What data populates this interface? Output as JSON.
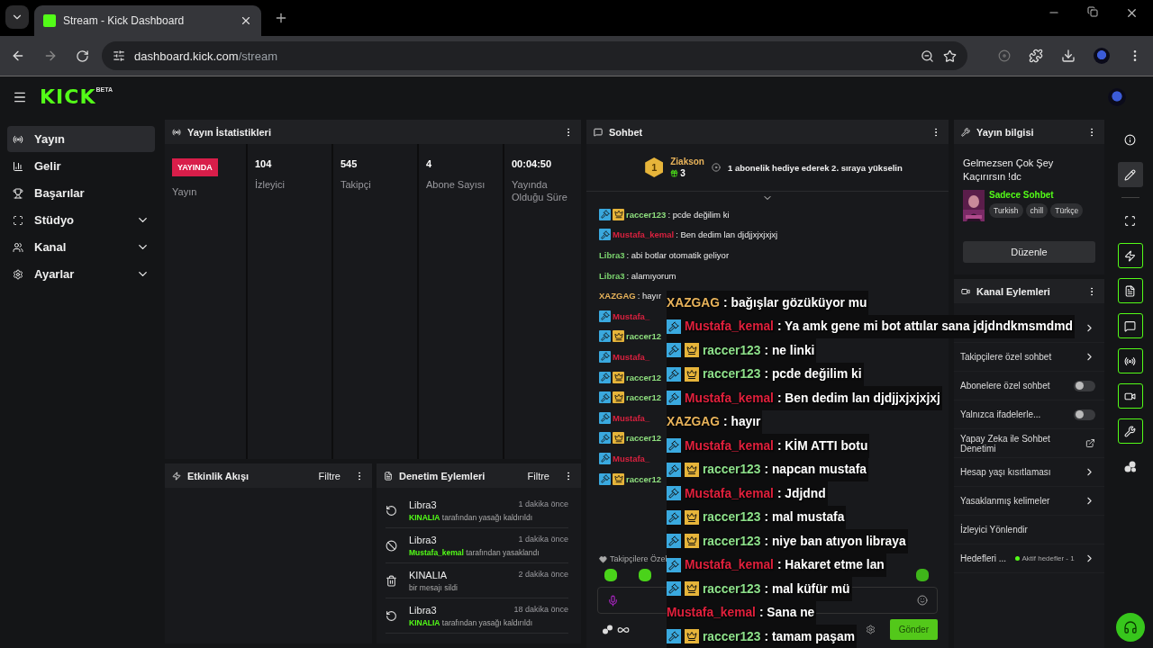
{
  "browser": {
    "tab_title": "Stream - Kick Dashboard",
    "url_host": "dashboard.kick.com",
    "url_path": "/stream"
  },
  "header": {
    "logo": "KICK",
    "logo_badge": "BETA"
  },
  "sidebar": {
    "items": [
      {
        "label": "Yayın",
        "selected": true,
        "expandable": false
      },
      {
        "label": "Gelir",
        "selected": false,
        "expandable": false
      },
      {
        "label": "Başarılar",
        "selected": false,
        "expandable": false
      },
      {
        "label": "Stüdyo",
        "selected": false,
        "expandable": true
      },
      {
        "label": "Kanal",
        "selected": false,
        "expandable": true
      },
      {
        "label": "Ayarlar",
        "selected": false,
        "expandable": true
      }
    ]
  },
  "stats": {
    "title": "Yayın İstatistikleri",
    "status": "YAYINDA",
    "status_label": "Yayın",
    "metrics": [
      {
        "value": "104",
        "label": "İzleyici"
      },
      {
        "value": "545",
        "label": "Takipçi"
      },
      {
        "value": "4",
        "label": "Abone Sayısı"
      },
      {
        "value": "00:04:50",
        "label": "Yayında Olduğu Süre"
      }
    ]
  },
  "activity": {
    "title": "Etkinlik Akışı",
    "filter": "Filtre"
  },
  "moderation": {
    "title": "Denetim Eylemleri",
    "filter": "Filtre",
    "entries": [
      {
        "kind": "unban",
        "user": "Libra3",
        "time": "1 dakika önce",
        "actor": "KINALIA",
        "action": "tarafından yasağı kaldırıldı"
      },
      {
        "kind": "ban",
        "user": "Libra3",
        "time": "1 dakika önce",
        "actor": "Mustafa_kemal",
        "action": "tarafından yasaklandı"
      },
      {
        "kind": "delete",
        "user": "KINALIA",
        "time": "2 dakika önce",
        "action": "bir mesajı sildi"
      },
      {
        "kind": "unban",
        "user": "Libra3",
        "time": "18 dakika önce",
        "actor": "KINALIA",
        "action": "tarafından yasağı kaldırıldı"
      }
    ]
  },
  "chat": {
    "title": "Sohbet",
    "leader": {
      "rank": "1",
      "name": "Ziakson",
      "gifts": "3"
    },
    "promo": "1 abonelik hediye ederek 2. sıraya yükselin",
    "messages": [
      {
        "kind": "full",
        "user": "raccer123",
        "color": "#8fe07f",
        "text": ": pcde değilim ki",
        "moderator": true,
        "subscriber": true
      },
      {
        "kind": "full",
        "user": "Mustafa_kemal",
        "color": "#d9213f",
        "text": ": Ben dedim lan djdjjxjxjxjxj",
        "moderator": true,
        "subscriber": false
      },
      {
        "kind": "full",
        "user": "Libra3",
        "color": "#7bd36e",
        "text": ": abi botlar otomatik geliyor",
        "moderator": false,
        "subscriber": false
      },
      {
        "kind": "full",
        "user": "Libra3",
        "color": "#7bd36e",
        "text": ": alamıyorum",
        "moderator": false,
        "subscriber": false
      },
      {
        "kind": "full",
        "user": "XAZGAG",
        "color": "#e8b35a",
        "text": ": hayır",
        "moderator": false,
        "subscriber": false
      },
      {
        "kind": "fragment",
        "user": "Mustafa_",
        "color": "#d9213f",
        "moderator": true,
        "subscriber": false
      },
      {
        "kind": "fragment",
        "user": "raccer12",
        "color": "#8fe07f",
        "moderator": true,
        "subscriber": true
      },
      {
        "kind": "fragment",
        "user": "Mustafa_",
        "color": "#d9213f",
        "moderator": true,
        "subscriber": false
      },
      {
        "kind": "fragment",
        "user": "raccer12",
        "color": "#8fe07f",
        "moderator": true,
        "subscriber": true
      },
      {
        "kind": "fragment",
        "user": "raccer12",
        "color": "#8fe07f",
        "moderator": true,
        "subscriber": true
      },
      {
        "kind": "fragment",
        "user": "Mustafa_",
        "color": "#d9213f",
        "moderator": true,
        "subscriber": false
      },
      {
        "kind": "fragment",
        "user": "raccer12",
        "color": "#8fe07f",
        "moderator": true,
        "subscriber": true
      },
      {
        "kind": "fragment",
        "user": "Mustafa_",
        "color": "#d9213f",
        "moderator": true,
        "subscriber": false
      },
      {
        "kind": "fragment",
        "user": "raccer12",
        "color": "#8fe07f",
        "moderator": true,
        "subscriber": true
      }
    ],
    "follower_label": "Takipçilere Özel",
    "send": "Gönder"
  },
  "stream_info": {
    "title": "Yayın bilgisi",
    "stream_title": "Gelmezsen Çok Şey Kaçırırsın !dc",
    "category": "Sadece Sohbet",
    "tags": [
      "Turkish",
      "chill",
      "Türkçe"
    ],
    "edit": "Düzenle"
  },
  "channel_actions": {
    "title": "Kanal Eylemleri",
    "items": [
      {
        "kind": "chevron"
      },
      {
        "kind": "chevron",
        "label": "Takipçilere özel sohbet"
      },
      {
        "kind": "toggle",
        "label": "Abonelere özel sohbet",
        "on": false
      },
      {
        "kind": "toggle",
        "label": "Yalnızca ifadelerle...",
        "on": false
      },
      {
        "kind": "external",
        "label": "Yapay Zeka ile Sohbet Denetimi"
      },
      {
        "kind": "chevron",
        "label": "Hesap yaşı kısıtlaması"
      },
      {
        "kind": "chevron",
        "label": "Yasaklanmış kelimeler"
      },
      {
        "kind": "plain",
        "label": "İzleyici Yönlendir"
      },
      {
        "kind": "goal",
        "label": "Hedefleri ...",
        "status": "Aktif hedefler - 1"
      }
    ]
  },
  "rail": {
    "items": [
      {
        "selected": false,
        "highlighted": false
      },
      {
        "selected": true,
        "highlighted": false
      },
      {
        "selected": false,
        "highlighted": false
      },
      {
        "selected": false,
        "highlighted": true
      },
      {
        "selected": false,
        "highlighted": true
      },
      {
        "selected": false,
        "highlighted": true
      },
      {
        "selected": false,
        "highlighted": true
      },
      {
        "selected": false,
        "highlighted": true
      },
      {
        "selected": false,
        "highlighted": true
      },
      {
        "selected": false,
        "highlighted": false
      }
    ]
  },
  "overlay": {
    "messages": [
      {
        "user": "XAZGAG",
        "color": "#e8b35a",
        "text": ": bağışlar gözüküyor mu",
        "moderator": false,
        "subscriber": false
      },
      {
        "user": "Mustafa_kemal",
        "color": "#e0203c",
        "text": ": Ya amk gene mi bot attılar sana jdjdndkmsmdmd",
        "moderator": true,
        "subscriber": false
      },
      {
        "user": "raccer123",
        "color": "#8de08a",
        "text": ": ne linki",
        "moderator": true,
        "subscriber": true
      },
      {
        "user": "raccer123",
        "color": "#8de08a",
        "text": ": pcde değilim ki",
        "moderator": true,
        "subscriber": true
      },
      {
        "user": "Mustafa_kemal",
        "color": "#e0203c",
        "text": ": Ben dedim lan djdjjxjxjxjxj",
        "moderator": true,
        "subscriber": false
      },
      {
        "user": "XAZGAG",
        "color": "#e8b35a",
        "text": ": hayır",
        "moderator": false,
        "subscriber": false
      },
      {
        "user": "Mustafa_kemal",
        "color": "#e0203c",
        "text": ": KİM ATTI botu",
        "moderator": true,
        "subscriber": false
      },
      {
        "user": "raccer123",
        "color": "#8de08a",
        "text": ": napcan mustafa",
        "moderator": true,
        "subscriber": true
      },
      {
        "user": "Mustafa_kemal",
        "color": "#e0203c",
        "text": ": Jdjdnd",
        "moderator": true,
        "subscriber": false
      },
      {
        "user": "raccer123",
        "color": "#8de08a",
        "text": ": mal mustafa",
        "moderator": true,
        "subscriber": true
      },
      {
        "user": "raccer123",
        "color": "#8de08a",
        "text": ": niye ban atıyon libraya",
        "moderator": true,
        "subscriber": true
      },
      {
        "user": "Mustafa_kemal",
        "color": "#e0203c",
        "text": ": Hakaret etme lan",
        "moderator": true,
        "subscriber": false
      },
      {
        "user": "raccer123",
        "color": "#8de08a",
        "text": ": mal küfür mü",
        "moderator": true,
        "subscriber": true
      },
      {
        "user": "Mustafa_kemal",
        "color": "#e0203c",
        "text": ": Sana ne",
        "moderator": false,
        "subscriber": false
      },
      {
        "user": "raccer123",
        "color": "#8de08a",
        "text": ": tamam paşam",
        "moderator": true,
        "subscriber": true
      }
    ]
  }
}
